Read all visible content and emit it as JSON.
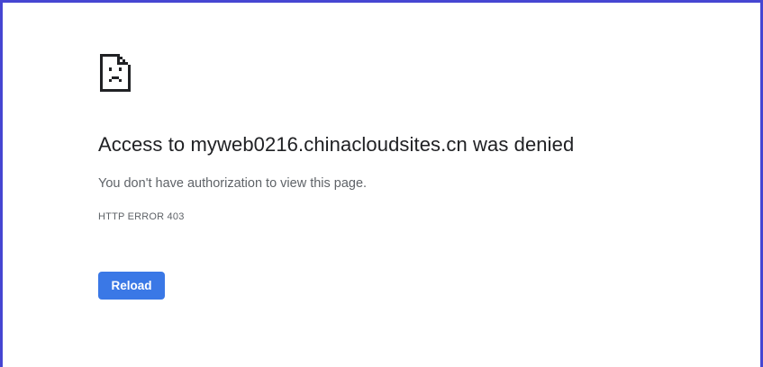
{
  "page": {
    "icon": "sad-document-icon",
    "title": "Access to myweb0216.chinacloudsites.cn was denied",
    "message": "You don't have authorization to view this page.",
    "error_code": "HTTP ERROR 403",
    "reload_label": "Reload"
  },
  "colors": {
    "frame_border": "#4646d2",
    "title_text": "#202124",
    "body_text": "#5f6368",
    "button_bg": "#3a78e6",
    "button_text": "#ffffff"
  }
}
